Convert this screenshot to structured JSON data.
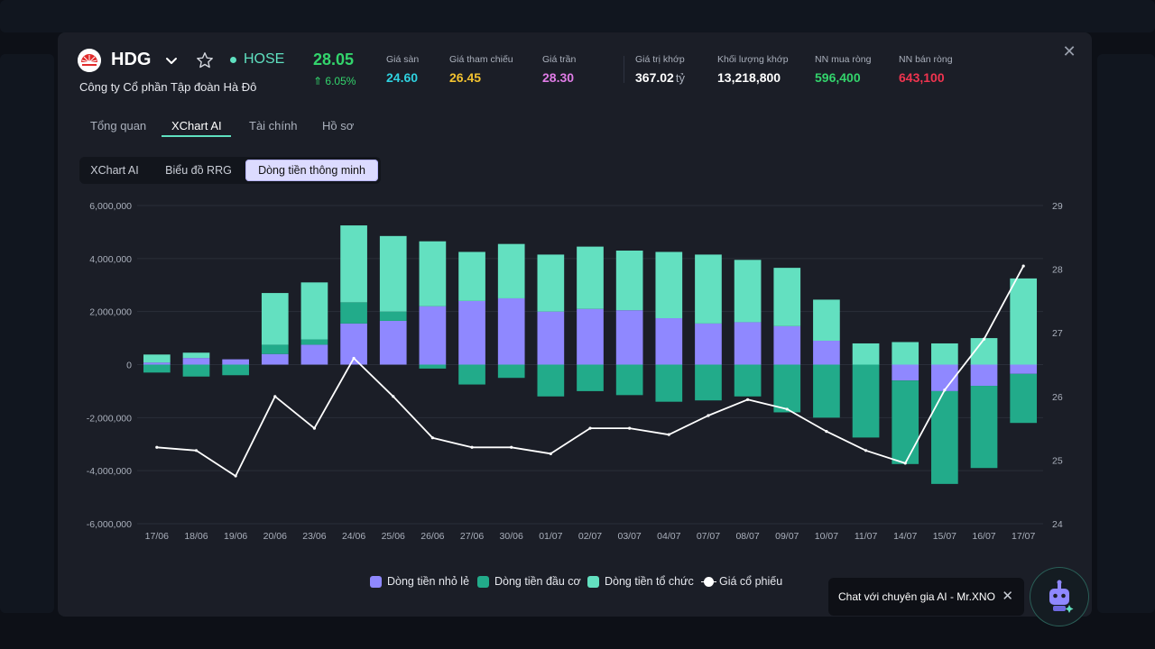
{
  "header": {
    "ticker": "HDG",
    "exchange": "HOSE",
    "company_name": "Công ty Cổ phần Tập đoàn Hà Đô",
    "price": "28.05",
    "change": "6.05%",
    "stats": [
      {
        "label": "Giá sàn",
        "value": "24.60",
        "color": "#2fd2e0"
      },
      {
        "label": "Giá tham chiếu",
        "value": "26.45",
        "color": "#f2c230"
      },
      {
        "label": "Giá trần",
        "value": "28.30",
        "color": "#e07ce6"
      },
      {
        "label": "Giá trị khớp",
        "value": "367.02",
        "unit": "tỷ",
        "color": "#ffffff"
      },
      {
        "label": "Khối lượng khớp",
        "value": "13,218,800",
        "color": "#ffffff"
      },
      {
        "label": "NN mua ròng",
        "value": "596,400",
        "color": "#33d46c"
      },
      {
        "label": "NN bán ròng",
        "value": "643,100",
        "color": "#f0344f"
      }
    ]
  },
  "tabs": [
    "Tổng quan",
    "XChart AI",
    "Tài chính",
    "Hồ sơ"
  ],
  "active_tab": "XChart AI",
  "subtabs": [
    "XChart AI",
    "Biểu đồ RRG",
    "Dòng tiền thông minh"
  ],
  "active_subtab": "Dòng tiền thông minh",
  "legend": [
    "Dòng tiền nhỏ lẻ",
    "Dòng tiền đầu cơ",
    "Dòng tiền tổ chức",
    "Giá cổ phiếu"
  ],
  "chat": {
    "label": "Chat với chuyên gia AI - Mr.XNO"
  },
  "colors": {
    "retail": "#8f88ff",
    "speculative": "#22ab8a",
    "institutional": "#63e0c0",
    "price": "#ffffff",
    "accent": "#5fe0c0"
  },
  "chart_data": {
    "type": "bar",
    "stacked": true,
    "categories": [
      "17/06",
      "18/06",
      "19/06",
      "20/06",
      "23/06",
      "24/06",
      "25/06",
      "26/06",
      "27/06",
      "30/06",
      "01/07",
      "02/07",
      "03/07",
      "04/07",
      "07/07",
      "08/07",
      "09/07",
      "10/07",
      "11/07",
      "14/07",
      "15/07",
      "16/07",
      "17/07"
    ],
    "ylim": [
      -6000000,
      6000000
    ],
    "yticks": [
      "6,000,000",
      "4,000,000",
      "2,000,000",
      "0",
      "-2,000,000",
      "-4,000,000",
      "-6,000,000"
    ],
    "y2lim": [
      24,
      29
    ],
    "y2ticks": [
      "29",
      "28",
      "27",
      "26",
      "25",
      "24"
    ],
    "series": [
      {
        "name": "Dòng tiền nhỏ lẻ",
        "values": [
          80000,
          250000,
          200000,
          400000,
          750000,
          1550000,
          1650000,
          2200000,
          2400000,
          2500000,
          2000000,
          2100000,
          2050000,
          1750000,
          1550000,
          1600000,
          1450000,
          900000,
          0,
          -600000,
          -1000000,
          -800000,
          -350000
        ]
      },
      {
        "name": "Dòng tiền đầu cơ",
        "values": [
          -300000,
          -450000,
          -400000,
          350000,
          200000,
          800000,
          350000,
          -150000,
          -750000,
          -500000,
          -1200000,
          -1000000,
          -1150000,
          -1400000,
          -1350000,
          -1200000,
          -1800000,
          -2000000,
          -2750000,
          -3150000,
          -3500000,
          -3100000,
          -1850000
        ]
      },
      {
        "name": "Dòng tiền tổ chức",
        "values": [
          300000,
          200000,
          0,
          1950000,
          2150000,
          2900000,
          2850000,
          2450000,
          1850000,
          2050000,
          2150000,
          2350000,
          2250000,
          2500000,
          2600000,
          2350000,
          2200000,
          1550000,
          800000,
          850000,
          800000,
          1000000,
          3250000
        ]
      }
    ],
    "price": {
      "name": "Giá cổ phiếu",
      "values": [
        25.2,
        25.15,
        24.75,
        26.0,
        25.5,
        26.6,
        26.0,
        25.35,
        25.2,
        25.2,
        25.1,
        25.5,
        25.5,
        25.4,
        25.7,
        25.95,
        25.8,
        25.45,
        25.15,
        24.95,
        26.1,
        26.9,
        28.05
      ]
    }
  }
}
